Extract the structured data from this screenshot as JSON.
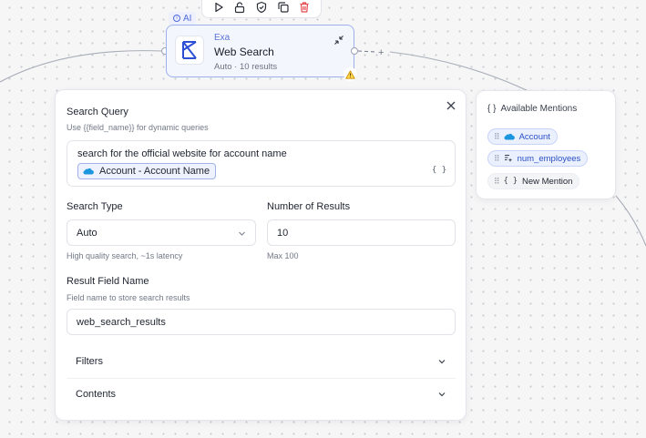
{
  "colors": {
    "accent": "#4f6bd8",
    "node_border": "#9db0ee",
    "delete": "#e5484d",
    "warning": "#f5b300"
  },
  "toolbar": {
    "buttons": [
      "play-icon",
      "unlock-icon",
      "shield-check-icon",
      "copy-icon",
      "trash-icon"
    ]
  },
  "node": {
    "badge": "AI",
    "provider": "Exa",
    "title": "Web Search",
    "meta": "Auto · 10 results",
    "add_label": "+"
  },
  "form": {
    "query_label": "Search Query",
    "query_hint": "Use {{field_name}} for dynamic queries",
    "query_text": "search for the official website for account name",
    "query_chip": "Account - Account Name",
    "braces": "{ }",
    "search_type_label": "Search Type",
    "search_type_value": "Auto",
    "search_type_hint": "High quality search, ~1s latency",
    "num_results_label": "Number of Results",
    "num_results_value": "10",
    "num_results_hint": "Max 100",
    "result_field_label": "Result Field Name",
    "result_field_hint": "Field name to store search results",
    "result_field_value": "web_search_results",
    "filters_label": "Filters",
    "contents_label": "Contents"
  },
  "mentions": {
    "title": "Available Mentions",
    "title_icon": "{ }",
    "items": [
      {
        "label": "Account",
        "icon": "salesforce-icon",
        "style": "blue"
      },
      {
        "label": "num_employees",
        "icon": "ai-field-icon",
        "style": "blue"
      },
      {
        "label": "New Mention",
        "icon": "braces-icon",
        "icon_text": "{ }",
        "style": "gray"
      }
    ],
    "grip": "⠿"
  }
}
